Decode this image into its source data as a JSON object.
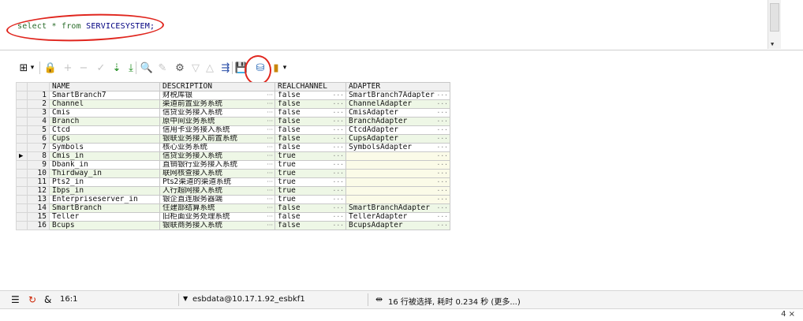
{
  "editor": {
    "sql_prefix": "select * from ",
    "sql_table": "SERVICESYSTEM;"
  },
  "toolbar": {
    "buttons": [
      {
        "name": "grid-layout-icon",
        "glyph": "⊞"
      },
      {
        "name": "dropdown-arrow-icon",
        "glyph": "▾"
      },
      {
        "name": "lock-icon",
        "glyph": "🔒"
      },
      {
        "name": "add-record-icon",
        "glyph": "+"
      },
      {
        "name": "delete-record-icon",
        "glyph": "−"
      },
      {
        "name": "post-changes-icon",
        "glyph": "✓"
      },
      {
        "name": "fetch-next-page-icon",
        "glyph": "⇣"
      },
      {
        "name": "fetch-last-page-icon",
        "glyph": "⤓"
      },
      {
        "name": "query-by-example-icon",
        "glyph": "🔍"
      },
      {
        "name": "clear-icon",
        "glyph": "✎"
      },
      {
        "name": "filter-icon",
        "glyph": "⚙"
      },
      {
        "name": "sort-down-icon",
        "glyph": "▽"
      },
      {
        "name": "sort-up-icon",
        "glyph": "△"
      },
      {
        "name": "export-icon",
        "glyph": "⇶"
      },
      {
        "name": "save-icon",
        "glyph": "💾"
      },
      {
        "name": "export-data-icon",
        "glyph": "⛁"
      },
      {
        "name": "chart-icon",
        "glyph": "▮"
      },
      {
        "name": "chart-dropdown-icon",
        "glyph": "▾"
      }
    ]
  },
  "grid": {
    "columns": [
      "NAME",
      "DESCRIPTION",
      "REALCHANNEL",
      "ADAPTER"
    ],
    "current_row": 8,
    "rows": [
      {
        "n": "1",
        "name": "SmartBranch7",
        "desc": "财税库银",
        "real": "false",
        "adapter": "SmartBranch7Adapter"
      },
      {
        "n": "2",
        "name": "Channel",
        "desc": "渠道前置业务系统",
        "real": "false",
        "adapter": "ChannelAdapter"
      },
      {
        "n": "3",
        "name": "Cmis",
        "desc": "信贷业务接入系统",
        "real": "false",
        "adapter": "CmisAdapter"
      },
      {
        "n": "4",
        "name": "Branch",
        "desc": "原中间业务系统",
        "real": "false",
        "adapter": "BranchAdapter"
      },
      {
        "n": "5",
        "name": "Ctcd",
        "desc": "信用卡业务接入系统",
        "real": "false",
        "adapter": "CtcdAdapter"
      },
      {
        "n": "6",
        "name": "Cups",
        "desc": "银联业务接入前置系统",
        "real": "false",
        "adapter": "CupsAdapter"
      },
      {
        "n": "7",
        "name": "Symbols",
        "desc": "核心业务系统",
        "real": "false",
        "adapter": "SymbolsAdapter"
      },
      {
        "n": "8",
        "name": "Cmis_in",
        "desc": "信贷业务接入系统",
        "real": "true",
        "adapter": ""
      },
      {
        "n": "9",
        "name": "Dbank_in",
        "desc": "直销银行业务接入系统",
        "real": "true",
        "adapter": ""
      },
      {
        "n": "10",
        "name": "Thirdway_in",
        "desc": "联网核查接入系统",
        "real": "true",
        "adapter": ""
      },
      {
        "n": "11",
        "name": "Pts2_in",
        "desc": "Pts2渠道的渠道系统",
        "real": "true",
        "adapter": ""
      },
      {
        "n": "12",
        "name": "Ibps_in",
        "desc": "人行超网接入系统",
        "real": "true",
        "adapter": ""
      },
      {
        "n": "13",
        "name": "Enterpriseserver_in",
        "desc": "银企直连服务器端",
        "real": "true",
        "adapter": ""
      },
      {
        "n": "14",
        "name": "SmartBranch",
        "desc": "住建部结算系统",
        "real": "false",
        "adapter": "SmartBranchAdapter"
      },
      {
        "n": "15",
        "name": "Teller",
        "desc": "旧柜面业务处理系统",
        "real": "false",
        "adapter": "TellerAdapter"
      },
      {
        "n": "16",
        "name": "Bcups",
        "desc": "银联商务接入系统",
        "real": "false",
        "adapter": "BcupsAdapter"
      }
    ]
  },
  "status": {
    "position": "16:1",
    "connection": "esbdata@10.17.1.92_esbkf1",
    "message": "16 行被选择, 耗时 0.234 秒 (更多...)",
    "panel_controls": "4 ×"
  }
}
